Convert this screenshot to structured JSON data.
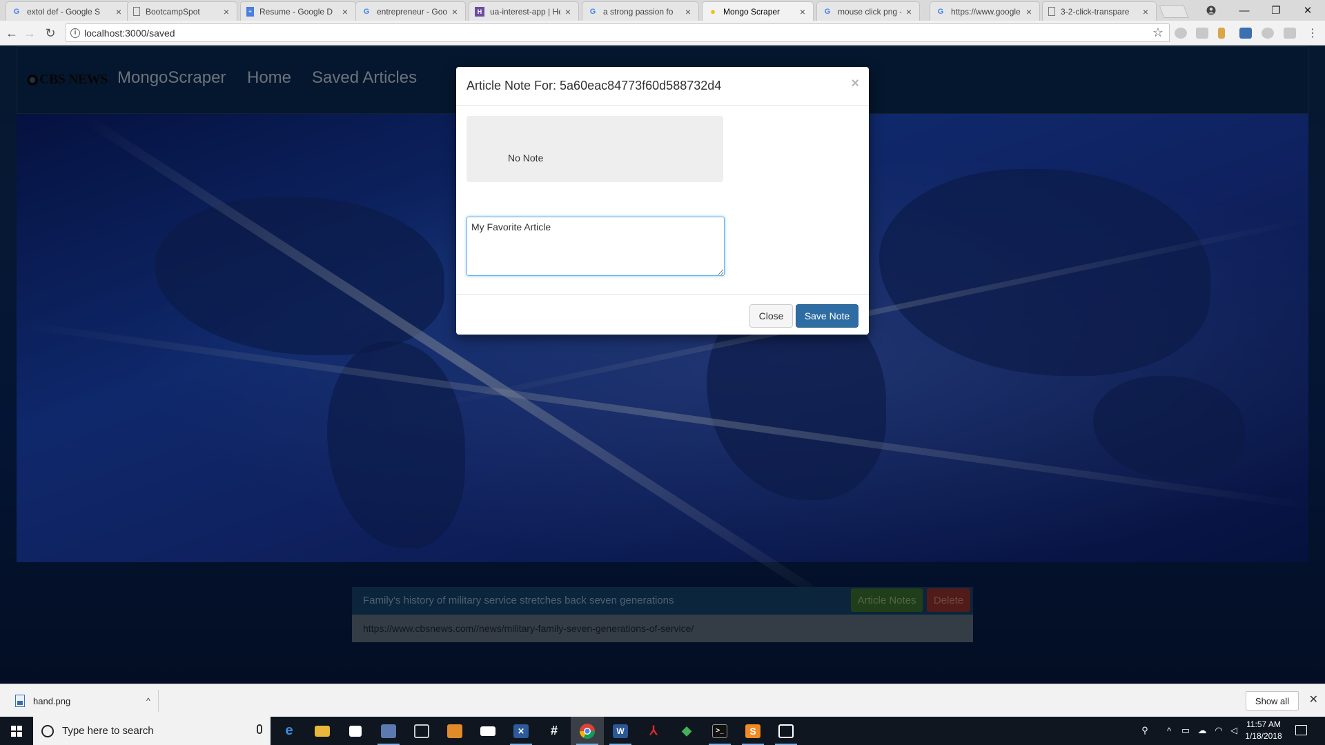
{
  "tabs": [
    {
      "title": "extol def - Google S",
      "icon": "google-icon"
    },
    {
      "title": "BootcampSpot",
      "icon": "page-icon"
    },
    {
      "title": "Resume - Google D",
      "icon": "docs-icon"
    },
    {
      "title": "entrepreneur - Goo",
      "icon": "google-icon"
    },
    {
      "title": "ua-interest-app | He",
      "icon": "heroku-icon"
    },
    {
      "title": "a strong passion fo",
      "icon": "google-icon"
    },
    {
      "title": "Mongo Scraper",
      "icon": "bulb-icon"
    },
    {
      "title": "mouse click png - G",
      "icon": "google-icon"
    },
    {
      "title": "https://www.google",
      "icon": "google-icon"
    },
    {
      "title": "3-2-click-transpare",
      "icon": "page-icon"
    }
  ],
  "address_bar": {
    "url": "localhost:3000/saved"
  },
  "site_nav": {
    "logo": "CBS NEWS",
    "brand": "MongoScraper",
    "links": [
      "Home",
      "Saved Articles"
    ]
  },
  "article": {
    "title": "Family's history of military service stretches back seven generations",
    "notes_label": "Article Notes",
    "delete_label": "Delete",
    "link": "https://www.cbsnews.com//news/military-family-seven-generations-of-service/"
  },
  "modal": {
    "title": "Article Note For: 5a60eac84773f60d588732d4",
    "close_symbol": "×",
    "existing_note": "No Note",
    "input_value": "My Favorite Article",
    "close_label": "Close",
    "save_label": "Save Note"
  },
  "downloads": {
    "file": "hand.png",
    "show_all": "Show all"
  },
  "taskbar": {
    "search_placeholder": "Type here to search",
    "time": "11:57 AM",
    "date": "1/18/2018"
  },
  "colors": {
    "save_button": "#2e6da4",
    "notes_button": "#3a6b2e",
    "delete_button": "#8b2f2c",
    "focus_ring": "#66afe9"
  }
}
